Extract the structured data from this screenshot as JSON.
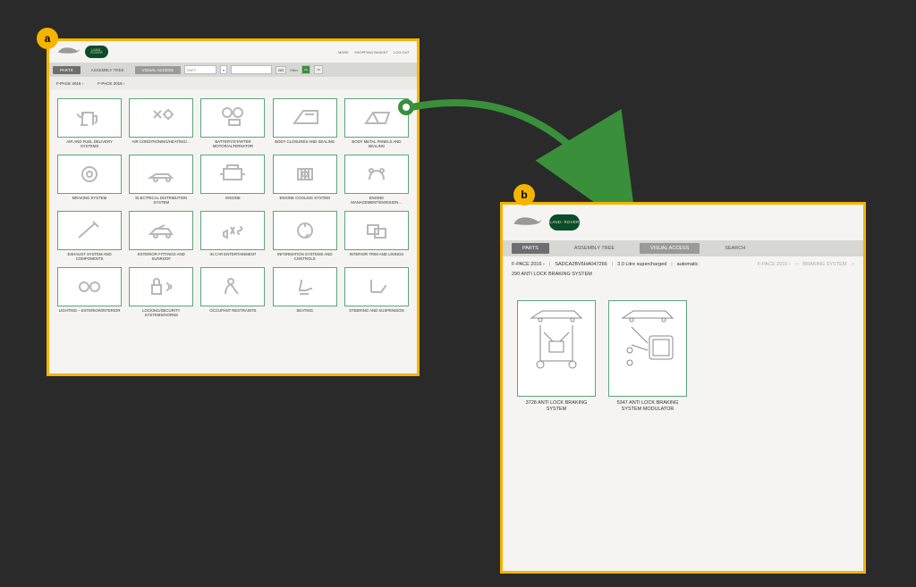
{
  "badge_a": "a",
  "badge_b": "b",
  "top_links": {
    "more": "MORE",
    "basket": "SHOPPING BASKET",
    "logout": "LOG OUT"
  },
  "tabs": {
    "parts": "PARTS",
    "assembly": "ASSEMBLY TREE",
    "visual": "VISUAL ACCESS",
    "search": "SEARCH"
  },
  "search": {
    "part_label": "PART",
    "go": "GO",
    "filter": "Filter",
    "on": "On",
    "off": "Off"
  },
  "breadcrumb_a": {
    "l1": "F-PACE 2016 ›",
    "l2": "F-PACE 2016 ›"
  },
  "categories": [
    {
      "label": "AIR AND FUEL DELIVERY SYSTEMS",
      "icon": "fuel"
    },
    {
      "label": "AIR CONDITIONING/HEATING/…",
      "icon": "ac"
    },
    {
      "label": "BATTERY/STARTER MOTOR/ALTERNATOR",
      "icon": "battery"
    },
    {
      "label": "BODY CLOSURES AND SEALING",
      "icon": "door"
    },
    {
      "label": "BODY METAL PANELS AND SEALING",
      "icon": "panel"
    },
    {
      "label": "BRAKING SYSTEM",
      "icon": "brake"
    },
    {
      "label": "ELECTRICAL DISTRIBUTION SYSTEM",
      "icon": "elec"
    },
    {
      "label": "ENGINE",
      "icon": "engine"
    },
    {
      "label": "ENGINE COOLING SYSTEM",
      "icon": "cooling"
    },
    {
      "label": "ENGINE MANAGEMENT/EMISSION…",
      "icon": "emission"
    },
    {
      "label": "EXHAUST SYSTEM AND COMPONENTS",
      "icon": "exhaust"
    },
    {
      "label": "EXTERIOR FITTINGS AND SUNROOF",
      "icon": "exterior"
    },
    {
      "label": "IN CAR ENTERTAINMENT",
      "icon": "ice"
    },
    {
      "label": "INFORMATION SYSTEMS AND CONTROLS",
      "icon": "info"
    },
    {
      "label": "INTERIOR TRIM AND LININGS",
      "icon": "interior"
    },
    {
      "label": "LIGHTING – EXTERIOR/INTERIOR",
      "icon": "lighting"
    },
    {
      "label": "LOCKING/SECURITY SYSTEMS/HORNS",
      "icon": "locking"
    },
    {
      "label": "OCCUPANT RESTRAINTS",
      "icon": "restraints"
    },
    {
      "label": "SEATING",
      "icon": "seating"
    },
    {
      "label": "STEERING AND SUSPENSION",
      "icon": "steering"
    }
  ],
  "breadcrumb_b": {
    "model": "F-PACE 2016 ›",
    "vin": "SADCA2BV6HA047266",
    "engine": "3.0 Litre supercharged",
    "trans": "automatic",
    "p1": "F-PACE 2016 ›",
    "p2": "BRAKING SYSTEM",
    "p3": "290 ANTI LOCK BRAKING SYSTEM",
    "sep": "|",
    "arrow": "››"
  },
  "parts": [
    {
      "label": "3728 ANTI LOCK BRAKING SYSTEM"
    },
    {
      "label": "5347 ANTI LOCK BRAKING SYSTEM MODULATOR"
    }
  ],
  "brand": {
    "landrover": "LAND-\nROVER"
  }
}
